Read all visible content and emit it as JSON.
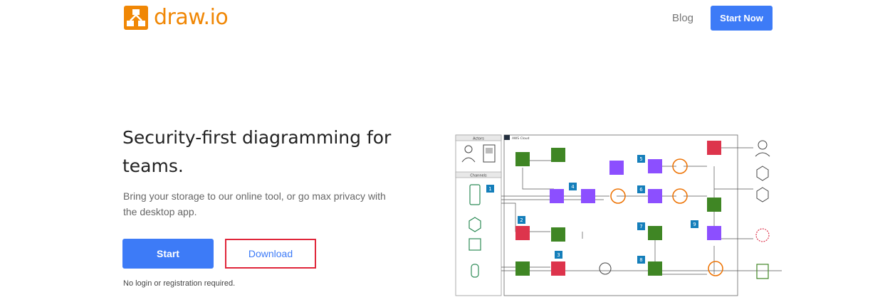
{
  "header": {
    "logo_text": "draw.io",
    "nav_blog": "Blog",
    "start_now_label": "Start Now",
    "accent_orange": "#f08705",
    "accent_blue": "#3d7bf7"
  },
  "hero": {
    "title": "Security-first diagramming for teams.",
    "subtitle": "Bring your storage to our online tool, or go max privacy with the desktop app.",
    "start_label": "Start",
    "download_label": "Download",
    "note": "No login or registration required."
  },
  "diagram": {
    "actors_header": "Actors",
    "channels_header": "Channels",
    "cloud_label": "AWS Cloud",
    "step_numbers": [
      "1",
      "2",
      "3",
      "4",
      "5",
      "6",
      "7",
      "8",
      "9"
    ]
  }
}
